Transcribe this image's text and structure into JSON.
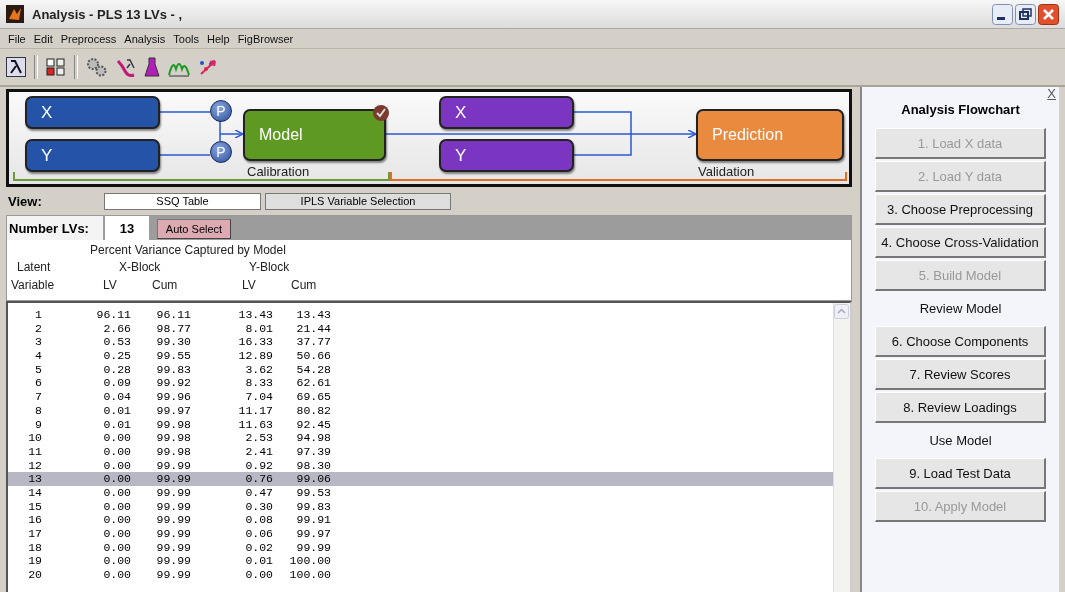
{
  "window": {
    "title": "Analysis - PLS 13 LVs - ,"
  },
  "menu": [
    "File",
    "Edit",
    "Preprocess",
    "Analysis",
    "Tools",
    "Help",
    "FigBrowser"
  ],
  "flowchart": {
    "nodes": [
      {
        "kind": "block",
        "label": "X",
        "color": "#2453a8"
      },
      {
        "kind": "block",
        "label": "Y",
        "color": "#2453a8"
      },
      {
        "kind": "preprocess",
        "label": "P"
      },
      {
        "kind": "preprocess",
        "label": "P"
      },
      {
        "kind": "step",
        "label": "Model",
        "color": "#5e9a22",
        "checked": true
      },
      {
        "kind": "block",
        "label": "X",
        "color": "#7a36c0"
      },
      {
        "kind": "block",
        "label": "Y",
        "color": "#7a36c0"
      },
      {
        "kind": "step",
        "label": "Prediction",
        "color": "#e98a3e",
        "checked": false
      }
    ],
    "sections": [
      {
        "label": "Calibration",
        "color": "#6a9a3a"
      },
      {
        "label": "Validation",
        "color": "#e07020"
      }
    ]
  },
  "view": {
    "label": "View:",
    "tabs": [
      {
        "label": "SSQ Table",
        "selected": true
      },
      {
        "label": "IPLS Variable Selection",
        "selected": false
      }
    ]
  },
  "number_lvs": {
    "label": "Number LVs:",
    "value": "13",
    "button": "Auto Select"
  },
  "table": {
    "title": "Percent Variance Captured by Model",
    "group_headers": [
      "Latent",
      "X-Block",
      "Y-Block"
    ],
    "columns": [
      "Variable",
      "LV",
      "Cum",
      "LV",
      "Cum"
    ],
    "rows": [
      {
        "cells": [
          "1",
          "96.11",
          "96.11",
          "13.43",
          "13.43"
        ],
        "selected": false
      },
      {
        "cells": [
          "2",
          "2.66",
          "98.77",
          "8.01",
          "21.44"
        ],
        "selected": false
      },
      {
        "cells": [
          "3",
          "0.53",
          "99.30",
          "16.33",
          "37.77"
        ],
        "selected": false
      },
      {
        "cells": [
          "4",
          "0.25",
          "99.55",
          "12.89",
          "50.66"
        ],
        "selected": false
      },
      {
        "cells": [
          "5",
          "0.28",
          "99.83",
          "3.62",
          "54.28"
        ],
        "selected": false
      },
      {
        "cells": [
          "6",
          "0.09",
          "99.92",
          "8.33",
          "62.61"
        ],
        "selected": false
      },
      {
        "cells": [
          "7",
          "0.04",
          "99.96",
          "7.04",
          "69.65"
        ],
        "selected": false
      },
      {
        "cells": [
          "8",
          "0.01",
          "99.97",
          "11.17",
          "80.82"
        ],
        "selected": false
      },
      {
        "cells": [
          "9",
          "0.01",
          "99.98",
          "11.63",
          "92.45"
        ],
        "selected": false
      },
      {
        "cells": [
          "10",
          "0.00",
          "99.98",
          "2.53",
          "94.98"
        ],
        "selected": false
      },
      {
        "cells": [
          "11",
          "0.00",
          "99.98",
          "2.41",
          "97.39"
        ],
        "selected": false
      },
      {
        "cells": [
          "12",
          "0.00",
          "99.99",
          "0.92",
          "98.30"
        ],
        "selected": false
      },
      {
        "cells": [
          "13",
          "0.00",
          "99.99",
          "0.76",
          "99.06"
        ],
        "selected": true
      },
      {
        "cells": [
          "14",
          "0.00",
          "99.99",
          "0.47",
          "99.53"
        ],
        "selected": false
      },
      {
        "cells": [
          "15",
          "0.00",
          "99.99",
          "0.30",
          "99.83"
        ],
        "selected": false
      },
      {
        "cells": [
          "16",
          "0.00",
          "99.99",
          "0.08",
          "99.91"
        ],
        "selected": false
      },
      {
        "cells": [
          "17",
          "0.00",
          "99.99",
          "0.06",
          "99.97"
        ],
        "selected": false
      },
      {
        "cells": [
          "18",
          "0.00",
          "99.99",
          "0.02",
          "99.99"
        ],
        "selected": false
      },
      {
        "cells": [
          "19",
          "0.00",
          "99.99",
          "0.01",
          "100.00"
        ],
        "selected": false
      },
      {
        "cells": [
          "20",
          "0.00",
          "99.99",
          "0.00",
          "100.00"
        ],
        "selected": false
      }
    ]
  },
  "flow_panel": {
    "close": "X",
    "title": "Analysis Flowchart",
    "items": [
      {
        "kind": "button",
        "label": "1. Load X data",
        "disabled": true
      },
      {
        "kind": "button",
        "label": "2. Load Y data",
        "disabled": true
      },
      {
        "kind": "button",
        "label": "3. Choose Preprocessing",
        "disabled": false
      },
      {
        "kind": "button",
        "label": "4. Choose Cross-Validation",
        "disabled": false
      },
      {
        "kind": "button",
        "label": "5. Build Model",
        "disabled": true
      },
      {
        "kind": "heading",
        "label": "Review Model"
      },
      {
        "kind": "button",
        "label": "6. Choose Components",
        "disabled": false
      },
      {
        "kind": "button",
        "label": "7. Review Scores",
        "disabled": false
      },
      {
        "kind": "button",
        "label": "8. Review Loadings",
        "disabled": false
      },
      {
        "kind": "heading",
        "label": "Use Model"
      },
      {
        "kind": "button",
        "label": "9. Load Test Data",
        "disabled": false
      },
      {
        "kind": "button",
        "label": "10. Apply Model",
        "disabled": true
      }
    ]
  }
}
